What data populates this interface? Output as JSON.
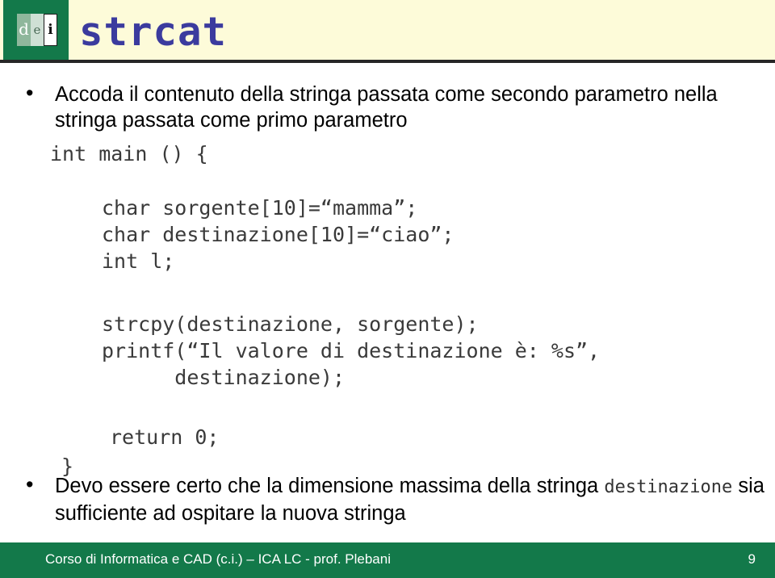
{
  "slide": {
    "title": "strcat",
    "logo": {
      "letter_d": "d",
      "letter_e": "e",
      "letter_i": "i"
    },
    "bullets": {
      "top": "Accoda il contenuto della stringa passata come secondo parametro nella stringa passata come primo parametro",
      "bottom_part1": "Devo essere certo che la dimensione massima della stringa ",
      "bottom_code": "destinazione",
      "bottom_part2": " sia sufficiente ad ospitare la nuova stringa"
    },
    "code": {
      "main_line": "int main () {",
      "declarations": "char sorgente[10]=“mamma”;\nchar destinazione[10]=“ciao”;\nint l;",
      "calls": "strcpy(destinazione, sorgente);\nprintf(“Il valore di destinazione è: %s”,\n      destinazione);",
      "return_line": "return 0;",
      "close_brace": "}"
    }
  },
  "footer": {
    "text": "Corso di Informatica e CAD (c.i.) – ICA LC - prof. Plebani",
    "page_number": "9"
  },
  "colors": {
    "brand_green": "#13794a",
    "header_cream": "#fdfbd9",
    "title_blue": "#3b3b9e",
    "code_gray": "#3a3a3a"
  }
}
